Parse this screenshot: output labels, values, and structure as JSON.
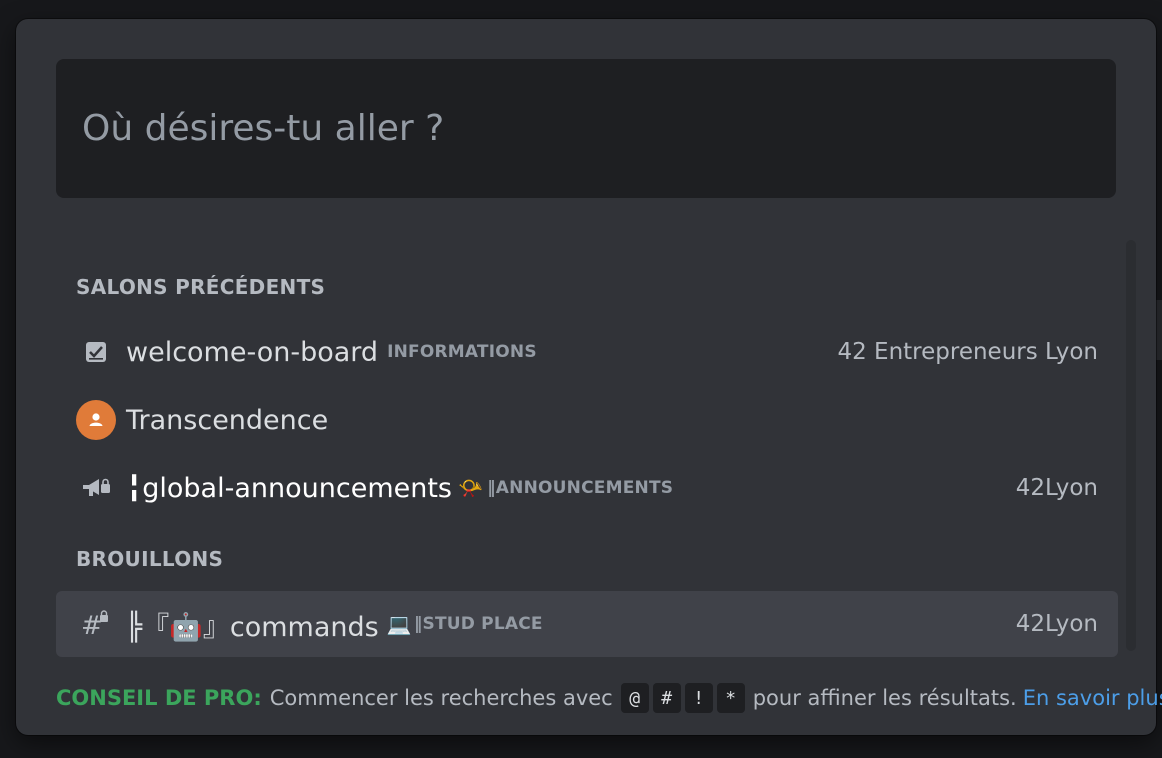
{
  "search": {
    "placeholder": "Où désires-tu aller ?"
  },
  "sections": {
    "recent_header": "SALONS PRÉCÉDENTS",
    "drafts_header": "BROUILLONS"
  },
  "recent_items": [
    {
      "icon": "rules-channel-icon",
      "name": "welcome-on-board",
      "category": "INFORMATIONS",
      "server": "42 Entrepreneurs Lyon"
    },
    {
      "icon": "user-avatar-icon",
      "name": "Transcendence",
      "category": "",
      "server": ""
    },
    {
      "icon": "announcement-channel-icon",
      "name": "╏global-announcements",
      "emoji": "📯",
      "category": "‖ANNOUNCEMENTS",
      "server": "42Lyon"
    }
  ],
  "draft_items": [
    {
      "icon": "locked-text-channel-icon",
      "name": "╠『🤖』commands",
      "emoji": "💻",
      "category": "‖STUD PLACE",
      "server": "42Lyon"
    }
  ],
  "tip": {
    "label": "CONSEIL DE PRO:",
    "text_before": "Commencer les recherches avec",
    "keys": [
      "@",
      "#",
      "!",
      "*"
    ],
    "text_after": "pour affiner les résultats.",
    "link": "En savoir plus"
  },
  "colors": {
    "modal_bg": "#313338",
    "search_bg": "#1e1f22",
    "selected_row": "#404249",
    "tip_label": "#3ba55c",
    "link": "#4c9ee8",
    "avatar": "#e07b39"
  }
}
